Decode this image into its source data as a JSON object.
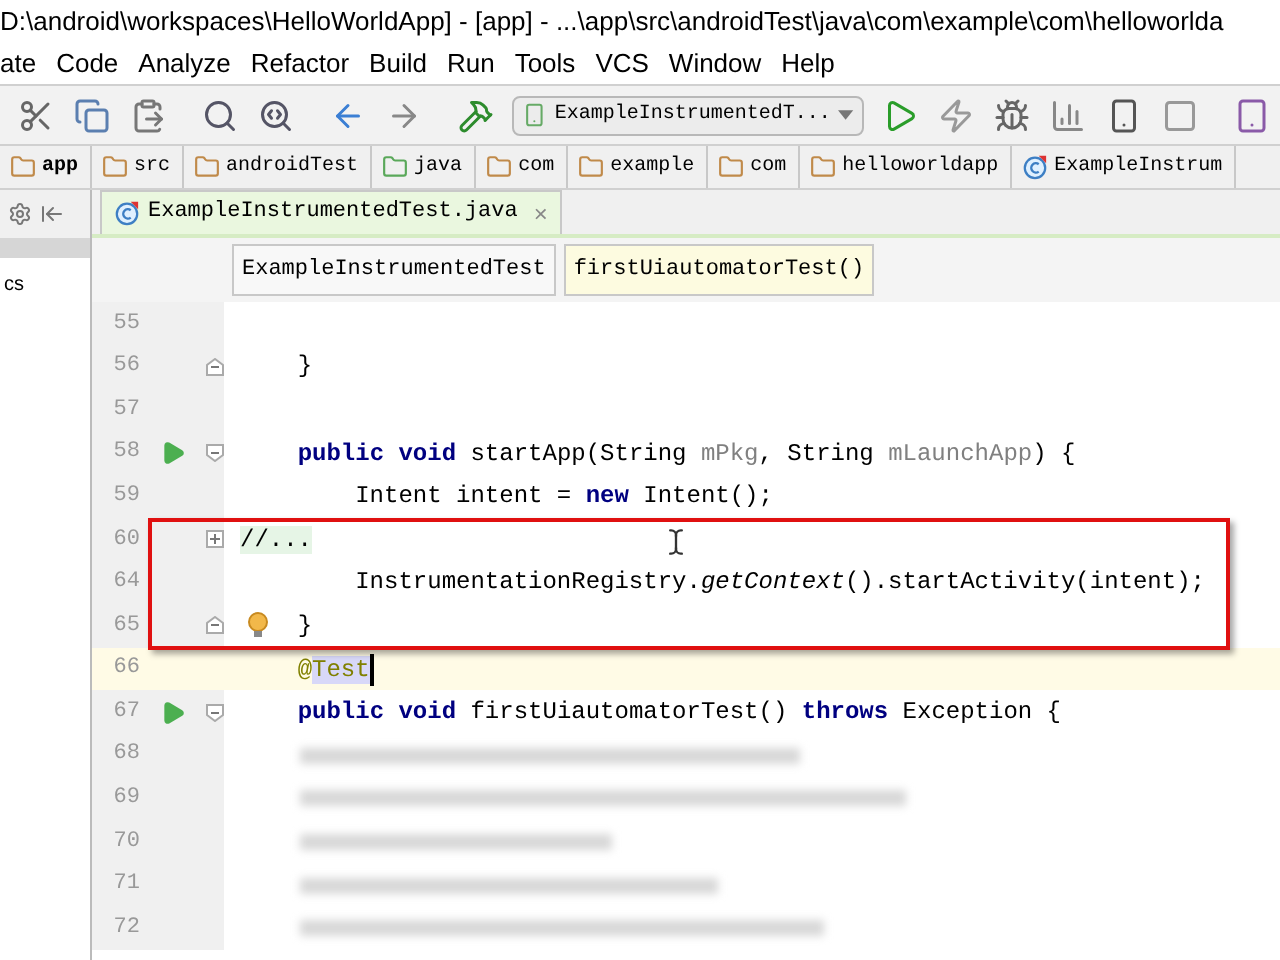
{
  "window": {
    "title": "D:\\android\\workspaces\\HelloWorldApp] - [app] - ...\\app\\src\\androidTest\\java\\com\\example\\com\\helloworlda"
  },
  "menu": [
    "ate",
    "Code",
    "Analyze",
    "Refactor",
    "Build",
    "Run",
    "Tools",
    "VCS",
    "Window",
    "Help"
  ],
  "toolbar": {
    "run_configuration": "ExampleInstrumentedT..."
  },
  "breadcrumbs": [
    {
      "label": "app",
      "kind": "module"
    },
    {
      "label": "src",
      "kind": "folder"
    },
    {
      "label": "androidTest",
      "kind": "folder"
    },
    {
      "label": "java",
      "kind": "source"
    },
    {
      "label": "com",
      "kind": "package"
    },
    {
      "label": "example",
      "kind": "package"
    },
    {
      "label": "com",
      "kind": "package"
    },
    {
      "label": "helloworldapp",
      "kind": "folder"
    },
    {
      "label": "ExampleInstrum",
      "kind": "class"
    }
  ],
  "project_panel": {
    "items": [
      "cs"
    ]
  },
  "editor_tabs": [
    {
      "label": "ExampleInstrumentedTest.java",
      "close": "×",
      "selected": true
    }
  ],
  "structure_crumbs": [
    {
      "label": "ExampleInstrumentedTest",
      "selected": false
    },
    {
      "label": "firstUiautomatorTest()",
      "selected": true
    }
  ],
  "lines": [
    {
      "number": "55",
      "kind": "plain",
      "run": false,
      "bulb": false,
      "current": false
    },
    {
      "number": "56",
      "kind": "closer",
      "tokens": [
        {
          "text": "    }",
          "kind": "plain"
        }
      ],
      "run": false,
      "bulb": false,
      "current": false
    },
    {
      "number": "57",
      "kind": "plain",
      "run": false,
      "bulb": false,
      "current": false
    },
    {
      "number": "58",
      "kind": "opener",
      "tokens": [
        {
          "text": "    public void ",
          "kind": "keyword"
        },
        {
          "text": "startApp(String ",
          "kind": "plain"
        },
        {
          "text": "mPkg",
          "kind": "param"
        },
        {
          "text": ", String ",
          "kind": "plain"
        },
        {
          "text": "mLaunchApp",
          "kind": "param"
        },
        {
          "text": ") {",
          "kind": "plain"
        }
      ],
      "run": true,
      "bulb": false,
      "current": false
    },
    {
      "number": "59",
      "kind": "plain",
      "tokens": [
        {
          "text": "        Intent intent = ",
          "kind": "plain"
        },
        {
          "text": "new ",
          "kind": "keyword"
        },
        {
          "text": "Intent();",
          "kind": "plain"
        }
      ],
      "run": false,
      "bulb": false,
      "current": false
    },
    {
      "number": "60",
      "kind": "collapsed",
      "tokens": [
        {
          "text": "//...",
          "kind": "folded"
        }
      ],
      "run": false,
      "bulb": false,
      "current": false
    },
    {
      "number": "64",
      "kind": "plain",
      "tokens": [
        {
          "text": "        InstrumentationRegistry.",
          "kind": "plain"
        },
        {
          "text": "getContext",
          "kind": "italic"
        },
        {
          "text": "().startActivity(intent);",
          "kind": "plain"
        }
      ],
      "run": false,
      "bulb": false,
      "current": false
    },
    {
      "number": "65",
      "kind": "closer",
      "tokens": [
        {
          "text": "    }",
          "kind": "plain"
        }
      ],
      "run": false,
      "bulb": true,
      "current": false
    },
    {
      "number": "66",
      "kind": "plain",
      "tokens": [
        {
          "text": "    @",
          "kind": "annotation"
        },
        {
          "text": "Test",
          "kind": "selection"
        }
      ],
      "run": false,
      "bulb": false,
      "current": true
    },
    {
      "number": "67",
      "kind": "opener",
      "tokens": [
        {
          "text": "    public void ",
          "kind": "keyword"
        },
        {
          "text": "firstUiautomatorTest() ",
          "kind": "plain"
        },
        {
          "text": "throws ",
          "kind": "keyword"
        },
        {
          "text": "Exception {",
          "kind": "plain"
        }
      ],
      "run": true,
      "bulb": false,
      "current": false
    },
    {
      "number": "68",
      "kind": "blurred",
      "run": false,
      "bulb": false,
      "current": false
    },
    {
      "number": "69",
      "kind": "blurred",
      "run": false,
      "bulb": false,
      "current": false
    },
    {
      "number": "70",
      "kind": "blurred",
      "run": false,
      "bulb": false,
      "current": false
    },
    {
      "number": "71",
      "kind": "blurred",
      "run": false,
      "bulb": false,
      "current": false
    },
    {
      "number": "72",
      "kind": "blurred",
      "run": false,
      "bulb": false,
      "current": false
    }
  ]
}
